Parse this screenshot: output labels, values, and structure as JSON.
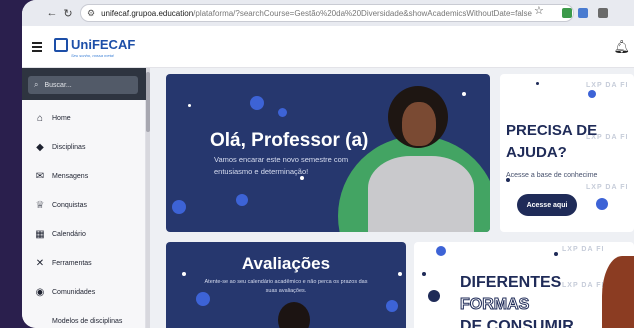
{
  "browser": {
    "url_host": "unifecaf.grupoa.education",
    "url_path": "/plataforma/?searchCourse=Gestão%20da%20Diversidade&showAcademicsWithoutDate=false",
    "icons": [
      "back-arrow-icon",
      "reload-icon",
      "site-settings-icon",
      "star-icon"
    ]
  },
  "header": {
    "logo_text": "UniFECAF",
    "logo_tagline": "Seu sonho, nossa meta!",
    "icons": [
      "hamburger-menu-icon",
      "bell-icon"
    ]
  },
  "sidebar": {
    "search_placeholder": "Buscar...",
    "items": [
      {
        "label": "Home",
        "icon": "home-icon"
      },
      {
        "label": "Disciplinas",
        "icon": "graduation-cap-icon"
      },
      {
        "label": "Mensagens",
        "icon": "envelope-icon"
      },
      {
        "label": "Conquistas",
        "icon": "trophy-icon"
      },
      {
        "label": "Calendário",
        "icon": "calendar-icon"
      },
      {
        "label": "Ferramentas",
        "icon": "tools-icon"
      },
      {
        "label": "Comunidades",
        "icon": "community-icon"
      },
      {
        "label": "Modelos de disciplinas",
        "icon": "models-icon"
      }
    ]
  },
  "banners": {
    "welcome": {
      "title": "Olá, Professor (a)",
      "subtitle": "Vamos encarar este novo semestre com entusiasmo e determinação!"
    },
    "help": {
      "title_line1": "PRECISA DE",
      "title_line2": "AJUDA?",
      "subtitle": "Acesse a base de conhecime",
      "button": "Acesse aqui",
      "watermark": "LXP DA FI"
    },
    "evaluations": {
      "title": "Avaliações",
      "subtitle": "Atente-se ao seu calendário acadêmico e não perca os prazos das suas avaliações."
    },
    "consumption": {
      "line1": "DIFERENTES",
      "line2": "FORMAS",
      "line3": "DE CONSUMIR",
      "watermark": "LXP DA FI"
    }
  },
  "colors": {
    "navy": "#26376e",
    "brand_blue": "#1d4fa8",
    "accent_green": "#43a463",
    "sidebar_dark": "#2e3440"
  }
}
